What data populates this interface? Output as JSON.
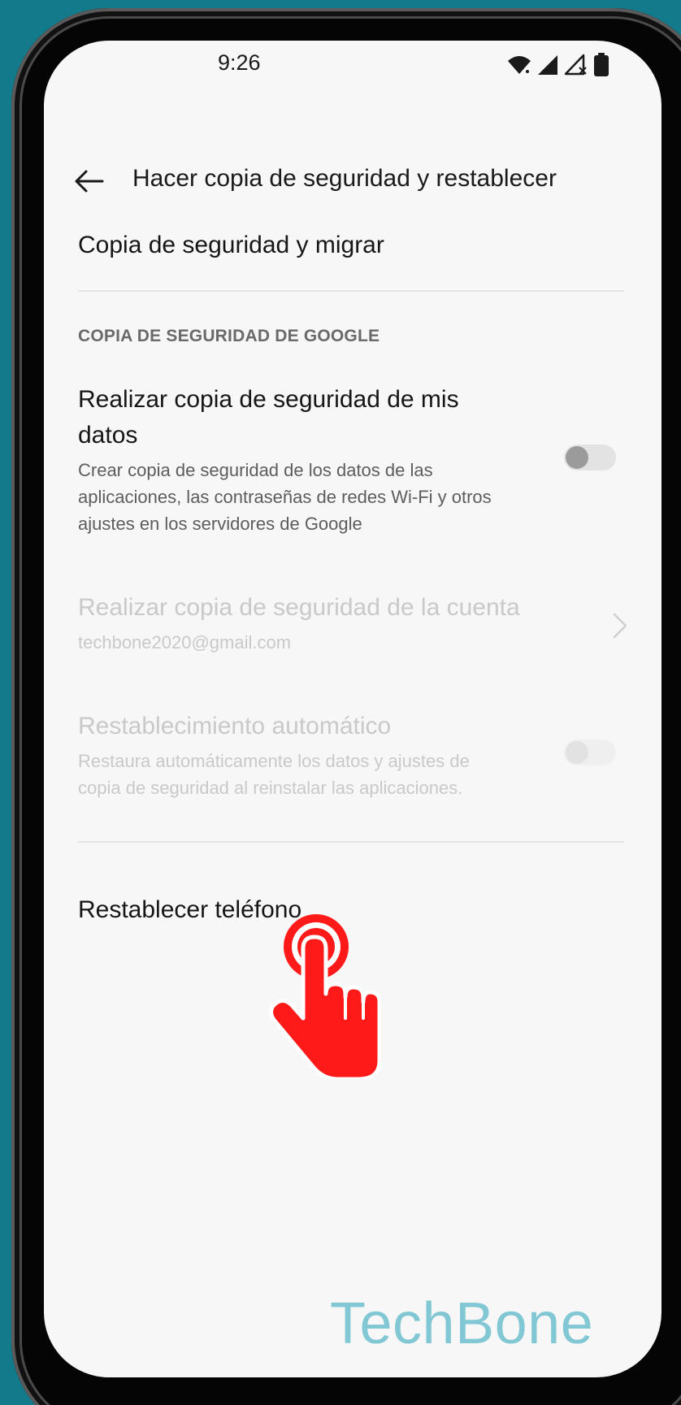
{
  "status_bar": {
    "time": "9:26",
    "icons": [
      "wifi-icon",
      "signal-icon",
      "signal-no-service-icon",
      "battery-icon"
    ]
  },
  "header": {
    "title": "Hacer copia de seguridad y restablecer",
    "back_icon": "arrow-left-icon"
  },
  "items": {
    "backup_migrate": {
      "title": "Copia de seguridad y migrar"
    },
    "google_section": {
      "header": "COPIA DE SEGURIDAD DE GOOGLE"
    },
    "backup_data": {
      "title_line1": "Realizar copia de seguridad de mis",
      "title_line2": "datos",
      "sub_line1": "Crear copia de seguridad de los datos de las",
      "sub_line2": "aplicaciones, las contraseñas de redes Wi-Fi y otros",
      "sub_line3": "ajustes en los servidores de Google",
      "toggle_on": false
    },
    "backup_account": {
      "title": "Realizar copia de seguridad de la cuenta",
      "email": "techbone2020@gmail.com",
      "enabled": false
    },
    "auto_restore": {
      "title": "Restablecimiento automático",
      "sub_line1": "Restaura automáticamente los datos y ajustes de",
      "sub_line2": "copia de seguridad al reinstalar las aplicaciones.",
      "toggle_on": false,
      "enabled": false
    },
    "reset_phone": {
      "title": "Restablecer teléfono"
    }
  },
  "overlay": {
    "tap_icon": "tap-hand-icon",
    "watermark": "TechBone"
  },
  "colors": {
    "background": "#137a8c",
    "screen": "#f7f7f7",
    "tap_red": "#ff1a1a",
    "watermark": "#7cc6d3"
  }
}
